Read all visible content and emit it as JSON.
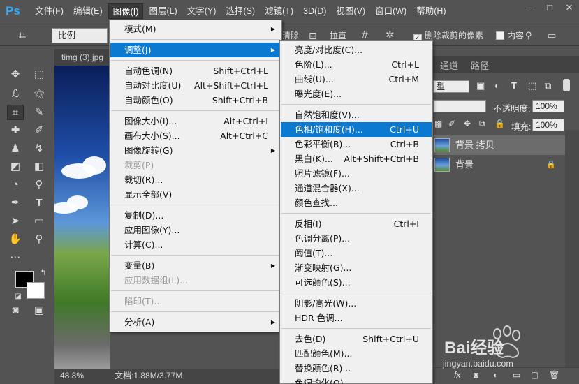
{
  "app": {
    "logo": "Ps",
    "menubar": [
      "文件(F)",
      "编辑(E)",
      "图像(I)",
      "图层(L)",
      "文字(Y)",
      "选择(S)",
      "滤镜(T)",
      "3D(D)",
      "视图(V)",
      "窗口(W)",
      "帮助(H)"
    ],
    "active_menu_index": 2,
    "window_controls": [
      "—",
      "□",
      "✕"
    ]
  },
  "options_bar": {
    "ratio_label": "比例",
    "clear_btn": "清除",
    "straighten_label": "拉直",
    "delete_cropped_label": "删除裁剪的像素",
    "delete_cropped_checked": "✓",
    "content_aware_label": "内容"
  },
  "document": {
    "tab_title": "timg (3).jpg",
    "zoom": "48.8%",
    "doc_info": "文档:1.88M/3.77M"
  },
  "panels": {
    "tabs": [
      "通道",
      "路径"
    ],
    "kind_value": "型",
    "opacity_label": "不透明度:",
    "opacity_value": "100%",
    "fill_label": "填充:",
    "fill_value": "100%",
    "layers": [
      {
        "name": "背景 拷贝",
        "locked": false
      },
      {
        "name": "背景",
        "locked": true
      }
    ],
    "lock_icon": "🔒"
  },
  "image_menu": [
    {
      "label": "模式(M)",
      "shortcut": "",
      "submenu": true
    },
    {
      "sep": true
    },
    {
      "label": "调整(J)",
      "shortcut": "",
      "submenu": true,
      "highlight": true
    },
    {
      "sep": true
    },
    {
      "label": "自动色调(N)",
      "shortcut": "Shift+Ctrl+L"
    },
    {
      "label": "自动对比度(U)",
      "shortcut": "Alt+Shift+Ctrl+L"
    },
    {
      "label": "自动颜色(O)",
      "shortcut": "Shift+Ctrl+B"
    },
    {
      "sep": true
    },
    {
      "label": "图像大小(I)...",
      "shortcut": "Alt+Ctrl+I"
    },
    {
      "label": "画布大小(S)...",
      "shortcut": "Alt+Ctrl+C"
    },
    {
      "label": "图像旋转(G)",
      "shortcut": "",
      "submenu": true
    },
    {
      "label": "裁剪(P)",
      "shortcut": "",
      "disabled": true
    },
    {
      "label": "裁切(R)...",
      "shortcut": ""
    },
    {
      "label": "显示全部(V)",
      "shortcut": ""
    },
    {
      "sep": true
    },
    {
      "label": "复制(D)...",
      "shortcut": ""
    },
    {
      "label": "应用图像(Y)...",
      "shortcut": ""
    },
    {
      "label": "计算(C)...",
      "shortcut": ""
    },
    {
      "sep": true
    },
    {
      "label": "变量(B)",
      "shortcut": "",
      "submenu": true
    },
    {
      "label": "应用数据组(L)...",
      "shortcut": "",
      "disabled": true
    },
    {
      "sep": true
    },
    {
      "label": "陷印(T)...",
      "shortcut": "",
      "disabled": true
    },
    {
      "sep": true
    },
    {
      "label": "分析(A)",
      "shortcut": "",
      "submenu": true
    }
  ],
  "adjust_menu": [
    {
      "label": "亮度/对比度(C)...",
      "shortcut": ""
    },
    {
      "label": "色阶(L)...",
      "shortcut": "Ctrl+L"
    },
    {
      "label": "曲线(U)...",
      "shortcut": "Ctrl+M"
    },
    {
      "label": "曝光度(E)...",
      "shortcut": ""
    },
    {
      "sep": true
    },
    {
      "label": "自然饱和度(V)...",
      "shortcut": ""
    },
    {
      "label": "色相/饱和度(H)...",
      "shortcut": "Ctrl+U",
      "highlight": true
    },
    {
      "label": "色彩平衡(B)...",
      "shortcut": "Ctrl+B"
    },
    {
      "label": "黑白(K)...",
      "shortcut": "Alt+Shift+Ctrl+B"
    },
    {
      "label": "照片滤镜(F)...",
      "shortcut": ""
    },
    {
      "label": "通道混合器(X)...",
      "shortcut": ""
    },
    {
      "label": "颜色查找...",
      "shortcut": ""
    },
    {
      "sep": true
    },
    {
      "label": "反相(I)",
      "shortcut": "Ctrl+I"
    },
    {
      "label": "色调分离(P)...",
      "shortcut": ""
    },
    {
      "label": "阈值(T)...",
      "shortcut": ""
    },
    {
      "label": "渐变映射(G)...",
      "shortcut": ""
    },
    {
      "label": "可选颜色(S)...",
      "shortcut": ""
    },
    {
      "sep": true
    },
    {
      "label": "阴影/高光(W)...",
      "shortcut": ""
    },
    {
      "label": "HDR 色调...",
      "shortcut": ""
    },
    {
      "sep": true
    },
    {
      "label": "去色(D)",
      "shortcut": "Shift+Ctrl+U"
    },
    {
      "label": "匹配颜色(M)...",
      "shortcut": ""
    },
    {
      "label": "替换颜色(R)...",
      "shortcut": ""
    },
    {
      "label": "色调均化(Q)",
      "shortcut": ""
    }
  ],
  "watermark": {
    "brand": "Bai经验",
    "url": "jingyan.baidu.com"
  },
  "colors": {
    "highlight": "#0b79d0",
    "ps_blue": "#31a8ff"
  }
}
